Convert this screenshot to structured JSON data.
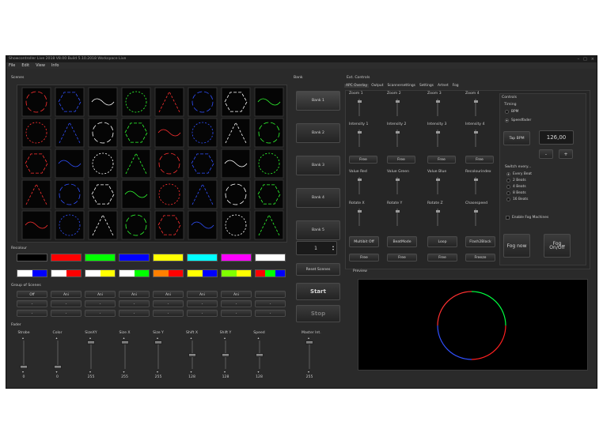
{
  "window": {
    "title": "Showcontroller Live 2018 V8.00 Build 5.10.2018  Workspace Live",
    "controls": [
      "–",
      "□",
      "×"
    ]
  },
  "menu": [
    "File",
    "Edit",
    "View",
    "Info"
  ],
  "scenes": {
    "label": "Scenes"
  },
  "bank": {
    "label": "Bank",
    "buttons": [
      "Bank 1",
      "Bank 2",
      "Bank 3",
      "Bank 4",
      "Bank 5"
    ],
    "spin_value": "1",
    "reset_label": "Reset Scenes",
    "start_label": "Start",
    "stop_label": "Stop"
  },
  "recolour": {
    "label": "Recolour",
    "swatches": [
      [
        "#000000"
      ],
      [
        "#ff0000"
      ],
      [
        "#00ff00"
      ],
      [
        "#0000ff"
      ],
      [
        "#ffff00"
      ],
      [
        "#00ffff"
      ],
      [
        "#ff00ff"
      ],
      [
        "#ffffff"
      ],
      [
        "#ffffff",
        "#0000ff"
      ],
      [
        "#ffffff",
        "#ff0000"
      ],
      [
        "#ffffff",
        "#ffff00"
      ],
      [
        "#ffffff",
        "#00ff00"
      ],
      [
        "#ff8000",
        "#ff0000"
      ],
      [
        "#ffff00",
        "#0000ff"
      ],
      [
        "#80ff00",
        "#ffff00"
      ],
      [
        "#ff0000",
        "#00ff00",
        "#0000ff"
      ]
    ]
  },
  "group_of_scenes": {
    "label": "Group of Scenes",
    "row1": [
      "Off",
      "Ani",
      "Ani",
      "Ani",
      "Ani",
      "Ani",
      "Ani",
      ""
    ],
    "row2": [
      "-",
      "-",
      "-",
      "-",
      "-",
      "-",
      "-",
      "-"
    ],
    "row3": [
      "-",
      "-",
      "-",
      "-",
      "-",
      "-",
      "-",
      "-"
    ]
  },
  "fader": {
    "label": "Fader",
    "channels": [
      {
        "name": "Strobe",
        "value": "0",
        "level": 0.0
      },
      {
        "name": "Color",
        "value": "0",
        "level": 0.0
      },
      {
        "name": "SizeXY",
        "value": "255",
        "level": 1.0
      },
      {
        "name": "Size X",
        "value": "255",
        "level": 1.0
      },
      {
        "name": "Size Y",
        "value": "255",
        "level": 1.0
      },
      {
        "name": "Shift X",
        "value": "128",
        "level": 0.5
      },
      {
        "name": "Shift Y",
        "value": "128",
        "level": 0.5
      },
      {
        "name": "Speed",
        "value": "128",
        "level": 0.5
      }
    ],
    "master": {
      "name": "Master Int.",
      "value": "255",
      "level": 1.0
    }
  },
  "ext_controls": {
    "label": "Ext. Controls",
    "tabs": [
      "APC Overlay",
      "Output",
      "Scannersettings",
      "Settings",
      "Artnet",
      "Fog"
    ],
    "row1": [
      "Zoom 1",
      "Zoom 2",
      "Zoom 3",
      "Zoom 4"
    ],
    "row2": [
      "Intensity 1",
      "Intensity 2",
      "Intensity 3",
      "Intensity 4"
    ],
    "row3": [
      "Value Red",
      "Value Green",
      "Value Blue",
      "Recolourindex"
    ],
    "row4": [
      "Rotate X",
      "Rotate Y",
      "Rotate Z",
      "Chasespeed"
    ],
    "free": "Free",
    "modes": [
      "Multibit Off",
      "BeatMode",
      "Loop",
      "Flash2Black"
    ],
    "bottom": [
      "Free",
      "Free",
      "Free",
      "Freeze"
    ]
  },
  "controls": {
    "label": "Controls",
    "timing_label": "Timing",
    "bpm_label": "BPM",
    "speedfader_label": "Speedfader",
    "tap_label": "Tap BPM",
    "bpm_value": "126,00",
    "minus": "-",
    "plus": "+",
    "switch_label": "Switch every...",
    "switch_options": [
      "Every Beat",
      "2 Beats",
      "4 Beats",
      "8 Beats",
      "16 Beats"
    ],
    "fog_enable": "Enable Fog Machines",
    "fog_now": "Fog now",
    "fog_onoff": "Fog On/Off"
  },
  "preview": {
    "label": "Preview"
  }
}
